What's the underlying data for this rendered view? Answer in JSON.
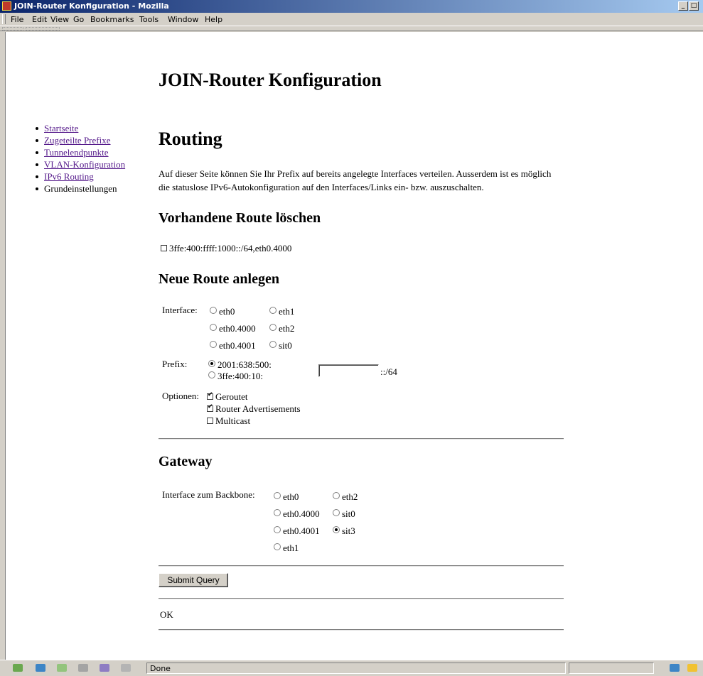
{
  "window": {
    "title": "JOIN-Router Konfiguration - Mozilla"
  },
  "menu": [
    "File",
    "Edit",
    "View",
    "Go",
    "Bookmarks",
    "Tools",
    "Window",
    "Help"
  ],
  "sidebar": {
    "items": [
      {
        "label": "Startseite",
        "link": true
      },
      {
        "label": "Zugeteilte Prefixe",
        "link": true
      },
      {
        "label": "Tunnelendpunkte",
        "link": true
      },
      {
        "label": "VLAN-Konfiguration",
        "link": true
      },
      {
        "label": "IPv6 Routing",
        "link": true
      },
      {
        "label": "Grundeinstellungen",
        "link": false
      }
    ]
  },
  "page": {
    "title": "JOIN-Router Konfiguration",
    "heading": "Routing",
    "intro": "Auf dieser Seite können Sie Ihr Prefix auf bereits angelegte Interfaces verteilen. Ausserdem ist es möglich die statuslose IPv6-Autokonfiguration auf den Interfaces/Links ein- bzw. auszuschalten."
  },
  "delete_route": {
    "heading": "Vorhandene Route löschen",
    "route": "3ffe:400:ffff:1000::/64,eth0.4000",
    "checked": false
  },
  "new_route": {
    "heading": "Neue Route anlegen",
    "interface_label": "Interface:",
    "interfaces": [
      {
        "label": "eth0",
        "checked": false
      },
      {
        "label": "eth1",
        "checked": false
      },
      {
        "label": "eth0.4000",
        "checked": false
      },
      {
        "label": "eth2",
        "checked": false
      },
      {
        "label": "eth0.4001",
        "checked": false
      },
      {
        "label": "sit0",
        "checked": false
      }
    ],
    "prefix_label": "Prefix:",
    "prefixes": [
      {
        "label": "2001:638:500:",
        "checked": true
      },
      {
        "label": "3ffe:400:10:",
        "checked": false
      }
    ],
    "prefix_value": "",
    "prefix_suffix": "::/64",
    "options_label": "Optionen:",
    "options": [
      {
        "label": "Geroutet",
        "checked": true
      },
      {
        "label": "Router Advertisements",
        "checked": true
      },
      {
        "label": "Multicast",
        "checked": false
      }
    ]
  },
  "gateway": {
    "heading": "Gateway",
    "backbone_label": "Interface zum Backbone:",
    "interfaces": [
      {
        "label": "eth0",
        "checked": false
      },
      {
        "label": "eth2",
        "checked": false
      },
      {
        "label": "eth0.4000",
        "checked": false
      },
      {
        "label": "sit0",
        "checked": false
      },
      {
        "label": "eth0.4001",
        "checked": false
      },
      {
        "label": "sit3",
        "checked": true
      },
      {
        "label": "eth1",
        "checked": false
      }
    ]
  },
  "submit_label": "Submit Query",
  "result": "OK",
  "status": {
    "text": "Done"
  },
  "colors": {
    "link": "#551a8b",
    "chrome": "#d4d0c8",
    "titlebar": "#0a246a"
  }
}
